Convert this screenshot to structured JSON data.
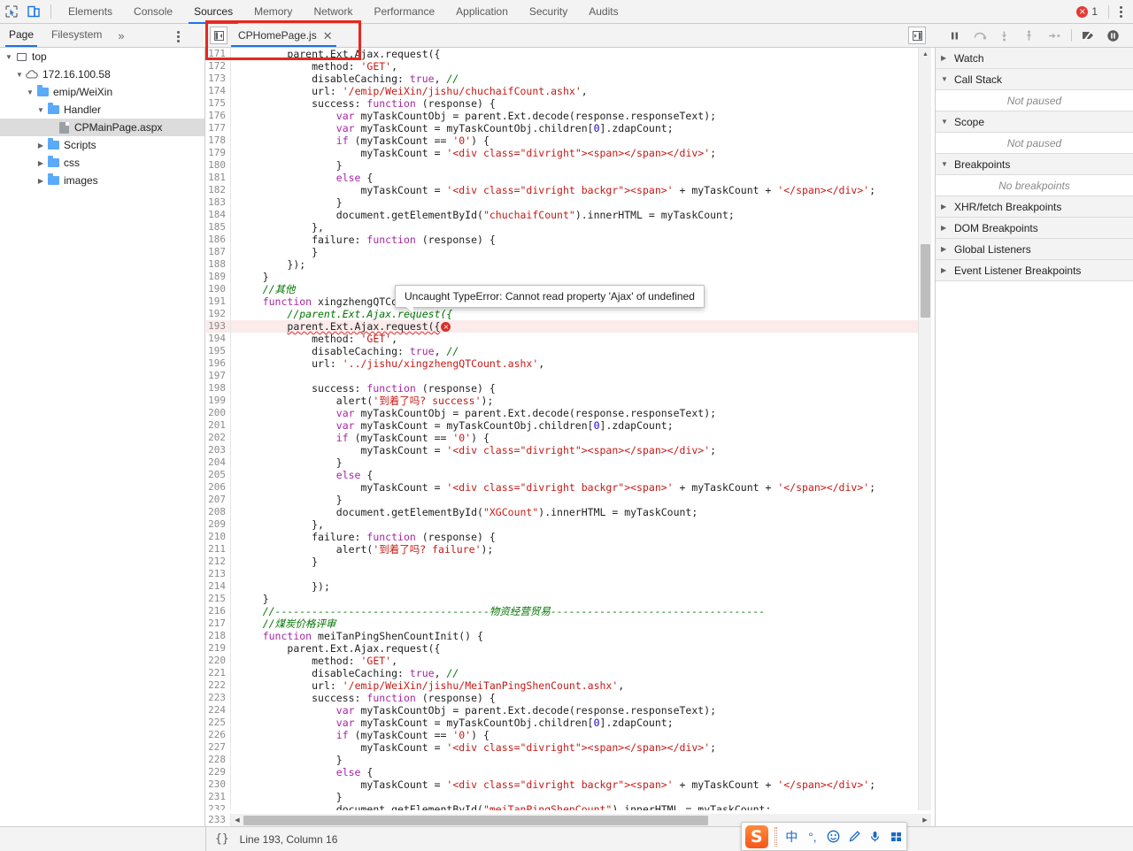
{
  "toolbar": {
    "inspect_icon": "inspect-cursor-icon",
    "device_icon": "device-toolbar-icon",
    "tabs": [
      {
        "label": "Elements",
        "active": false
      },
      {
        "label": "Console",
        "active": false
      },
      {
        "label": "Sources",
        "active": true
      },
      {
        "label": "Memory",
        "active": false
      },
      {
        "label": "Network",
        "active": false
      },
      {
        "label": "Performance",
        "active": false
      },
      {
        "label": "Application",
        "active": false
      },
      {
        "label": "Security",
        "active": false
      },
      {
        "label": "Audits",
        "active": false
      }
    ],
    "error_count": "1",
    "error_glyph": "×",
    "more_icon": "kebab-menu-icon"
  },
  "navigator": {
    "tabs": [
      {
        "label": "Page",
        "active": true
      },
      {
        "label": "Filesystem",
        "active": false
      }
    ],
    "overflow_glyph": "»",
    "more_icon": "kebab-menu-icon",
    "tree": [
      {
        "label": "top",
        "depth": 0,
        "icon": "frame-icon",
        "twisty": "▼",
        "selected": false
      },
      {
        "label": "172.16.100.58",
        "depth": 1,
        "icon": "cloud-icon",
        "twisty": "▼",
        "selected": false
      },
      {
        "label": "emip/WeiXin",
        "depth": 2,
        "icon": "folder-icon",
        "twisty": "▼",
        "selected": false
      },
      {
        "label": "Handler",
        "depth": 3,
        "icon": "folder-icon",
        "twisty": "▼",
        "selected": false
      },
      {
        "label": "CPMainPage.aspx",
        "depth": 4,
        "icon": "document-icon",
        "twisty": "",
        "selected": true
      },
      {
        "label": "Scripts",
        "depth": 3,
        "icon": "folder-icon",
        "twisty": "▶",
        "selected": false
      },
      {
        "label": "css",
        "depth": 3,
        "icon": "folder-icon",
        "twisty": "▶",
        "selected": false
      },
      {
        "label": "images",
        "depth": 3,
        "icon": "folder-icon",
        "twisty": "▶",
        "selected": false
      }
    ]
  },
  "source_tabs": {
    "collapse_left_icon": "collapse-navigator-icon",
    "collapse_right_icon": "expand-panel-icon",
    "files": [
      {
        "name": "CPHomePage.js",
        "close_glyph": "✕",
        "active": true
      }
    ]
  },
  "debugger_toolbar": {
    "buttons": [
      {
        "name": "pause-resume-button",
        "icon": "pause-icon"
      },
      {
        "name": "step-over-button",
        "icon": "step-over-icon"
      },
      {
        "name": "step-into-button",
        "icon": "step-into-icon"
      },
      {
        "name": "step-out-button",
        "icon": "step-out-icon"
      },
      {
        "name": "step-button",
        "icon": "step-icon"
      },
      {
        "name": "deactivate-breakpoints-button",
        "icon": "deactivate-breakpoints-icon"
      },
      {
        "name": "pause-on-exceptions-button",
        "icon": "pause-on-exceptions-icon"
      }
    ]
  },
  "debugger_panel": {
    "sections": [
      {
        "title": "Watch",
        "twisty": "▶",
        "body": null,
        "expanded": false
      },
      {
        "title": "Call Stack",
        "twisty": "▼",
        "body": "Not paused",
        "expanded": true
      },
      {
        "title": "Scope",
        "twisty": "▼",
        "body": "Not paused",
        "expanded": true
      },
      {
        "title": "Breakpoints",
        "twisty": "▼",
        "body": "No breakpoints",
        "expanded": true
      },
      {
        "title": "XHR/fetch Breakpoints",
        "twisty": "▶",
        "body": null,
        "expanded": false
      },
      {
        "title": "DOM Breakpoints",
        "twisty": "▶",
        "body": null,
        "expanded": false
      },
      {
        "title": "Global Listeners",
        "twisty": "▶",
        "body": null,
        "expanded": false
      },
      {
        "title": "Event Listener Breakpoints",
        "twisty": "▶",
        "body": null,
        "expanded": false
      }
    ]
  },
  "error_tooltip": {
    "message": "Uncaught TypeError: Cannot read property 'Ajax' of undefined"
  },
  "status_bar": {
    "format_icon": "{}",
    "text": "Line 193, Column 16"
  },
  "ime": {
    "logo": "S",
    "buttons": [
      {
        "name": "ime-language-button",
        "glyph": "中"
      },
      {
        "name": "ime-punctuation-button",
        "glyph": "°,"
      },
      {
        "name": "ime-emoji-button",
        "glyph": "☺"
      },
      {
        "name": "ime-skin-button",
        "glyph": "✎"
      },
      {
        "name": "ime-voice-button",
        "glyph": "ᵥ"
      },
      {
        "name": "ime-toolbox-button",
        "glyph": "▦"
      }
    ]
  },
  "scrollbars": {
    "vertical_up_glyph": "▲",
    "horizontal_left_glyph": "◀",
    "horizontal_right_glyph": "▶"
  },
  "code": {
    "first_line_number": 171,
    "error_line": 193,
    "lines": [
      {
        "n": 171,
        "html": "        <span class='pl'>parent.Ext.Ajax.request({</span>"
      },
      {
        "n": 172,
        "html": "            <span class='pl'>method: </span><span class='s'>'GET'</span><span class='pl'>,</span>"
      },
      {
        "n": 173,
        "html": "            <span class='pl'>disableCaching: </span><span class='k'>true</span><span class='pl'>, </span><span class='cm'>//</span>"
      },
      {
        "n": 174,
        "html": "            <span class='pl'>url: </span><span class='s'>'/emip/WeiXin/jishu/chuchaifCount.ashx'</span><span class='pl'>,</span>"
      },
      {
        "n": 175,
        "html": "            <span class='pl'>success: </span><span class='k'>function</span><span class='pl'> (response) {</span>"
      },
      {
        "n": 176,
        "html": "                <span class='k'>var</span><span class='pl'> myTaskCountObj = parent.Ext.decode(response.responseText);</span>"
      },
      {
        "n": 177,
        "html": "                <span class='k'>var</span><span class='pl'> myTaskCount = myTaskCountObj.children[</span><span class='nb'>0</span><span class='pl'>].zdapCount;</span>"
      },
      {
        "n": 178,
        "html": "                <span class='k'>if</span><span class='pl'> (myTaskCount == </span><span class='s'>'0'</span><span class='pl'>) {</span>"
      },
      {
        "n": 179,
        "html": "                    <span class='pl'>myTaskCount = </span><span class='s'>'&lt;div class=\"divright\"&gt;&lt;span&gt;&lt;/span&gt;&lt;/div&gt;'</span><span class='pl'>;</span>"
      },
      {
        "n": 180,
        "html": "                <span class='pl'>}</span>"
      },
      {
        "n": 181,
        "html": "                <span class='k'>else</span><span class='pl'> {</span>"
      },
      {
        "n": 182,
        "html": "                    <span class='pl'>myTaskCount = </span><span class='s'>'&lt;div class=\"divright backgr\"&gt;&lt;span&gt;'</span><span class='pl'> + myTaskCount + </span><span class='s'>'&lt;/span&gt;&lt;/div&gt;'</span><span class='pl'>;</span>"
      },
      {
        "n": 183,
        "html": "                <span class='pl'>}</span>"
      },
      {
        "n": 184,
        "html": "                <span class='pl'>document.getElementById(</span><span class='s'>\"chuchaifCount\"</span><span class='pl'>).innerHTML = myTaskCount;</span>"
      },
      {
        "n": 185,
        "html": "            <span class='pl'>},</span>"
      },
      {
        "n": 186,
        "html": "            <span class='pl'>failure: </span><span class='k'>function</span><span class='pl'> (response) {</span>"
      },
      {
        "n": 187,
        "html": "            <span class='pl'>}</span>"
      },
      {
        "n": 188,
        "html": "        <span class='pl'>});</span>"
      },
      {
        "n": 189,
        "html": "    <span class='pl'>}</span>"
      },
      {
        "n": 190,
        "html": "    <span class='cm'>//其他</span>"
      },
      {
        "n": 191,
        "html": "    <span class='k'>function</span><span class='pl'> xingzhengQTCountInit() {</span>"
      },
      {
        "n": 192,
        "html": "        <span class='cm'>//parent.Ext.Ajax.request({</span>"
      },
      {
        "n": 193,
        "html": "        <span class='pl hl-squiggle'>parent.Ext.Ajax.request({</span>",
        "error": true
      },
      {
        "n": 194,
        "html": "            <span class='pl'>method: </span><span class='s'>'GET'</span><span class='pl'>,</span>"
      },
      {
        "n": 195,
        "html": "            <span class='pl'>disableCaching: </span><span class='k'>true</span><span class='pl'>, </span><span class='cm'>//</span>"
      },
      {
        "n": 196,
        "html": "            <span class='pl'>url: </span><span class='s'>'../jishu/xingzhengQTCount.ashx'</span><span class='pl'>,</span>"
      },
      {
        "n": 197,
        "html": ""
      },
      {
        "n": 198,
        "html": "            <span class='pl'>success: </span><span class='k'>function</span><span class='pl'> (response) {</span>"
      },
      {
        "n": 199,
        "html": "                <span class='pl'>alert(</span><span class='s'>'到着了吗? success'</span><span class='pl'>);</span>"
      },
      {
        "n": 200,
        "html": "                <span class='k'>var</span><span class='pl'> myTaskCountObj = parent.Ext.decode(response.responseText);</span>"
      },
      {
        "n": 201,
        "html": "                <span class='k'>var</span><span class='pl'> myTaskCount = myTaskCountObj.children[</span><span class='nb'>0</span><span class='pl'>].zdapCount;</span>"
      },
      {
        "n": 202,
        "html": "                <span class='k'>if</span><span class='pl'> (myTaskCount == </span><span class='s'>'0'</span><span class='pl'>) {</span>"
      },
      {
        "n": 203,
        "html": "                    <span class='pl'>myTaskCount = </span><span class='s'>'&lt;div class=\"divright\"&gt;&lt;span&gt;&lt;/span&gt;&lt;/div&gt;'</span><span class='pl'>;</span>"
      },
      {
        "n": 204,
        "html": "                <span class='pl'>}</span>"
      },
      {
        "n": 205,
        "html": "                <span class='k'>else</span><span class='pl'> {</span>"
      },
      {
        "n": 206,
        "html": "                    <span class='pl'>myTaskCount = </span><span class='s'>'&lt;div class=\"divright backgr\"&gt;&lt;span&gt;'</span><span class='pl'> + myTaskCount + </span><span class='s'>'&lt;/span&gt;&lt;/div&gt;'</span><span class='pl'>;</span>"
      },
      {
        "n": 207,
        "html": "                <span class='pl'>}</span>"
      },
      {
        "n": 208,
        "html": "                <span class='pl'>document.getElementById(</span><span class='s'>\"XGCount\"</span><span class='pl'>).innerHTML = myTaskCount;</span>"
      },
      {
        "n": 209,
        "html": "            <span class='pl'>},</span>"
      },
      {
        "n": 210,
        "html": "            <span class='pl'>failure: </span><span class='k'>function</span><span class='pl'> (response) {</span>"
      },
      {
        "n": 211,
        "html": "                <span class='pl'>alert(</span><span class='s'>'到着了吗? failure'</span><span class='pl'>);</span>"
      },
      {
        "n": 212,
        "html": "            <span class='pl'>}</span>"
      },
      {
        "n": 213,
        "html": ""
      },
      {
        "n": 214,
        "html": "            <span class='pl'>});</span>"
      },
      {
        "n": 215,
        "html": "    <span class='pl'>}</span>"
      },
      {
        "n": 216,
        "html": "    <span class='cm'>//-----------------------------------物资经营贸易-----------------------------------</span>"
      },
      {
        "n": 217,
        "html": "    <span class='cm'>//煤炭价格评审</span>"
      },
      {
        "n": 218,
        "html": "    <span class='k'>function</span><span class='pl'> meiTanPingShenCountInit() {</span>"
      },
      {
        "n": 219,
        "html": "        <span class='pl'>parent.Ext.Ajax.request({</span>"
      },
      {
        "n": 220,
        "html": "            <span class='pl'>method: </span><span class='s'>'GET'</span><span class='pl'>,</span>"
      },
      {
        "n": 221,
        "html": "            <span class='pl'>disableCaching: </span><span class='k'>true</span><span class='pl'>, </span><span class='cm'>//</span>"
      },
      {
        "n": 222,
        "html": "            <span class='pl'>url: </span><span class='s'>'/emip/WeiXin/jishu/MeiTanPingShenCount.ashx'</span><span class='pl'>,</span>"
      },
      {
        "n": 223,
        "html": "            <span class='pl'>success: </span><span class='k'>function</span><span class='pl'> (response) {</span>"
      },
      {
        "n": 224,
        "html": "                <span class='k'>var</span><span class='pl'> myTaskCountObj = parent.Ext.decode(response.responseText);</span>"
      },
      {
        "n": 225,
        "html": "                <span class='k'>var</span><span class='pl'> myTaskCount = myTaskCountObj.children[</span><span class='nb'>0</span><span class='pl'>].zdapCount;</span>"
      },
      {
        "n": 226,
        "html": "                <span class='k'>if</span><span class='pl'> (myTaskCount == </span><span class='s'>'0'</span><span class='pl'>) {</span>"
      },
      {
        "n": 227,
        "html": "                    <span class='pl'>myTaskCount = </span><span class='s'>'&lt;div class=\"divright\"&gt;&lt;span&gt;&lt;/span&gt;&lt;/div&gt;'</span><span class='pl'>;</span>"
      },
      {
        "n": 228,
        "html": "                <span class='pl'>}</span>"
      },
      {
        "n": 229,
        "html": "                <span class='k'>else</span><span class='pl'> {</span>"
      },
      {
        "n": 230,
        "html": "                    <span class='pl'>myTaskCount = </span><span class='s'>'&lt;div class=\"divright backgr\"&gt;&lt;span&gt;'</span><span class='pl'> + myTaskCount + </span><span class='s'>'&lt;/span&gt;&lt;/div&gt;'</span><span class='pl'>;</span>"
      },
      {
        "n": 231,
        "html": "                <span class='pl'>}</span>"
      },
      {
        "n": 232,
        "html": "                <span class='pl'>document.getElementById(</span><span class='s'>\"meiTanPingShenCount\"</span><span class='pl'>).innerHTML = myTaskCount;</span>"
      }
    ],
    "last_gutter_number": 233
  }
}
